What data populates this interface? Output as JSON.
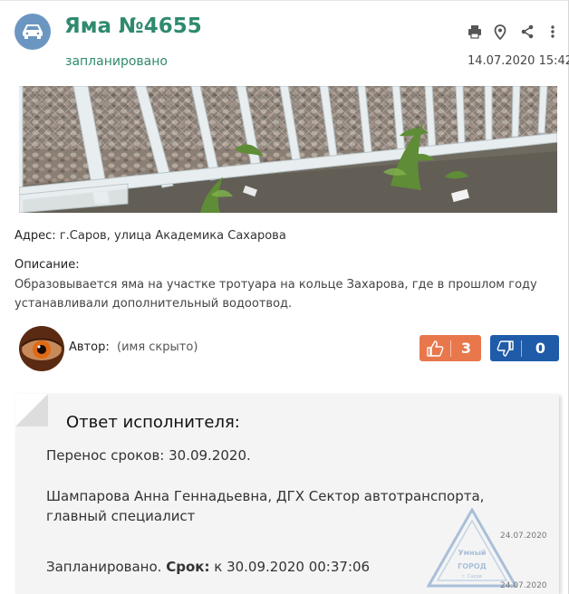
{
  "header": {
    "title": "Яма №4655",
    "status": "запланировано",
    "date": "14.07.2020 15:42",
    "category_icon": "car-icon",
    "colors": {
      "accent": "#2f8a6e",
      "icon_bg": "#6c96c2"
    }
  },
  "toolbar": {
    "icons": [
      "print-icon",
      "map-pin-icon",
      "share-icon",
      "more-vertical-icon"
    ]
  },
  "details": {
    "address_label": "Адрес:",
    "address_value": "г.Саров, улица Академика Сахарова",
    "description_label": "Описание:",
    "description_text": "Образовывается яма на участке тротуара на кольце Захарова, где в прошлом году устанавливали дополнительный водоотвод."
  },
  "author": {
    "label": "Автор:",
    "name": "(имя скрыто)"
  },
  "votes": {
    "likes": "3",
    "dislikes": "0",
    "colors": {
      "like": "#e8774c",
      "dislike": "#1f5ba8"
    }
  },
  "response": {
    "title": "Ответ исполнителя:",
    "line1": "Перенос сроков: 30.09.2020.",
    "line2": "Шампарова Анна Геннадьевна, ДГХ Сектор автотранспорта, главный специалист",
    "line3_status": "Запланировано.",
    "line3_deadline_label": "Срок:",
    "line3_deadline_value": "к 30.09.2020 00:37:06",
    "stamp_date_1": "24.07.2020",
    "stamp_date_2": "24.07.2020",
    "stamp_text_1": "Умный",
    "stamp_text_2": "ГОРОД",
    "stamp_text_3": "г. Саров"
  }
}
